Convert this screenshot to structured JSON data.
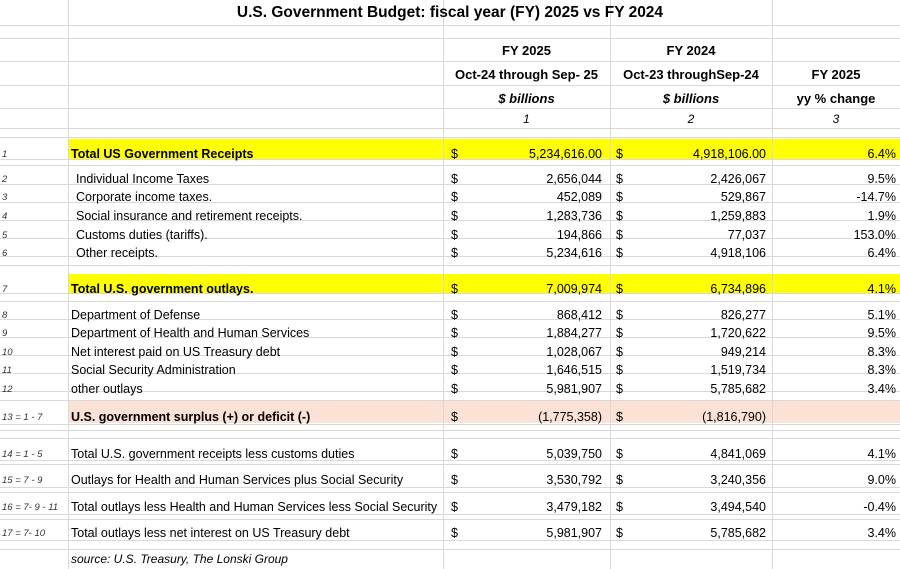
{
  "title": "U.S. Government Budget: fiscal year (FY) 2025  vs FY 2024",
  "headers": {
    "col1": {
      "line1": "FY 2025",
      "line2": "Oct-24 through Sep- 25",
      "line3": "$ billions",
      "num": "1"
    },
    "col2": {
      "line1": "FY 2024",
      "line2": "Oct-23 throughSep-24",
      "line3": "$ billions",
      "num": "2"
    },
    "col3": {
      "line1": "",
      "line2": "FY 2025",
      "line3": "yy % change",
      "num": "3"
    }
  },
  "currency_symbol": "$",
  "colors": {
    "highlight_yellow": "#ffff00",
    "highlight_peach": "#fbe2d5",
    "grid": "#d9d9d9"
  },
  "rows": [
    {
      "id": "1",
      "label": "Total US Government Receipts",
      "fy2025": "5,234,616.00",
      "fy2024": "4,918,106.00",
      "pct": "6.4%",
      "style": "yellow"
    },
    {
      "id": "2",
      "label": "Individual Income Taxes",
      "fy2025": "2,656,044",
      "fy2024": "2,426,067",
      "pct": "9.5%",
      "style": "indent"
    },
    {
      "id": "3",
      "label": "Corporate income taxes.",
      "fy2025": "452,089",
      "fy2024": "529,867",
      "pct": "-14.7%",
      "style": "indent"
    },
    {
      "id": "4",
      "label": "Social insurance and retirement receipts.",
      "fy2025": "1,283,736",
      "fy2024": "1,259,883",
      "pct": "1.9%",
      "style": "indent"
    },
    {
      "id": "5",
      "label": "Customs duties (tariffs).",
      "fy2025": "194,866",
      "fy2024": "77,037",
      "pct": "153.0%",
      "style": "indent"
    },
    {
      "id": "6",
      "label": "Other receipts.",
      "fy2025": "5,234,616",
      "fy2024": "4,918,106",
      "pct": "6.4%",
      "style": "indent"
    },
    {
      "id": "7",
      "label": "Total U.S. government outlays.",
      "fy2025": "7,009,974",
      "fy2024": "6,734,896",
      "pct": "4.1%",
      "style": "yellow"
    },
    {
      "id": "8",
      "label": "Department of Defense",
      "fy2025": "868,412",
      "fy2024": "826,277",
      "pct": "5.1%",
      "style": "plain"
    },
    {
      "id": "9",
      "label": "Department of Health and Human Services",
      "fy2025": "1,884,277",
      "fy2024": "1,720,622",
      "pct": "9.5%",
      "style": "plain"
    },
    {
      "id": "10",
      "label": "Net interest paid on US Treasury debt",
      "fy2025": "1,028,067",
      "fy2024": "949,214",
      "pct": "8.3%",
      "style": "plain"
    },
    {
      "id": "11",
      "label": "Social Security Administration",
      "fy2025": "1,646,515",
      "fy2024": "1,519,734",
      "pct": "8.3%",
      "style": "plain"
    },
    {
      "id": "12",
      "label": "other outlays",
      "fy2025": "5,981,907",
      "fy2024": "5,785,682",
      "pct": "3.4%",
      "style": "plain"
    },
    {
      "id": "13 = 1 - 7",
      "label": "U.S. government surplus (+) or deficit (-)",
      "fy2025": "(1,775,358)",
      "fy2024": "(1,816,790)",
      "pct": "",
      "style": "peach"
    },
    {
      "id": "14 = 1 - 5",
      "label": "Total U.S. government receipts less customs duties",
      "fy2025": "5,039,750",
      "fy2024": "4,841,069",
      "pct": "4.1%",
      "style": "plain"
    },
    {
      "id": "15 = 7 - 9",
      "label": "Outlays for Health and Human Services plus Social Security",
      "fy2025": "3,530,792",
      "fy2024": "3,240,356",
      "pct": "9.0%",
      "style": "plain"
    },
    {
      "id": "16 = 7- 9 - 11",
      "label": "Total outlays less Health and Human Services less Social Security",
      "fy2025": "3,479,182",
      "fy2024": "3,494,540",
      "pct": "-0.4%",
      "style": "plain"
    },
    {
      "id": "17 = 7- 10",
      "label": "Total outlays less net interest on US Treasury debt",
      "fy2025": "5,981,907",
      "fy2024": "5,785,682",
      "pct": "3.4%",
      "style": "plain"
    }
  ],
  "source": "source: U.S. Treasury, The Lonski Group"
}
